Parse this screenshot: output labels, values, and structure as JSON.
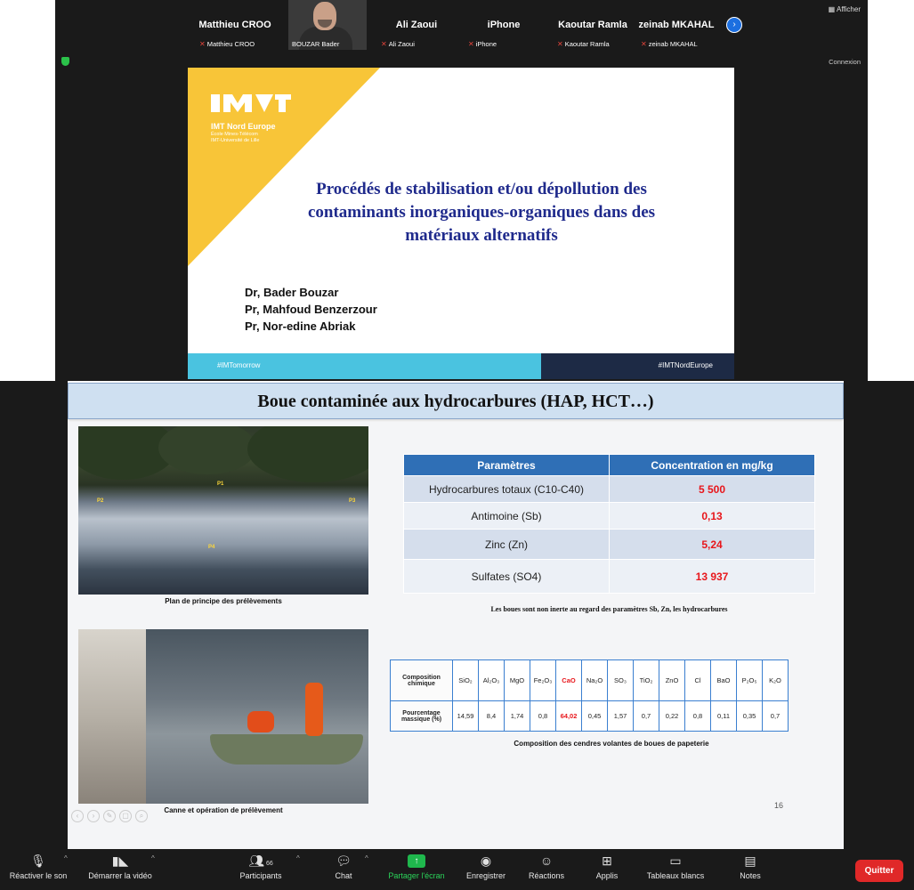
{
  "top_meeting": {
    "participants": [
      {
        "tile_name": "Matthieu CROO",
        "label": "Matthieu CROO",
        "muted": true
      },
      {
        "tile_name": "",
        "label": "BOUZAR Bader",
        "muted": false,
        "video": true
      },
      {
        "tile_name": "Ali Zaoui",
        "label": "Ali Zaoui",
        "muted": true
      },
      {
        "tile_name": "iPhone",
        "label": "iPhone",
        "muted": true
      },
      {
        "tile_name": "Kaoutar Ramla",
        "label": "Kaoutar Ramla",
        "muted": true
      },
      {
        "tile_name": "zeinab MKAHAL",
        "label": "zeinab MKAHAL",
        "muted": true
      }
    ],
    "view_label": "Afficher",
    "connexion_label": "Connexion"
  },
  "slide1": {
    "org_name": "IMT Nord Europe",
    "org_sub1": "École Mines-Télécom",
    "org_sub2": "IMT-Université de Lille",
    "title": "Procédés de stabilisation et/ou dépollution des contaminants inorganiques-organiques dans des matériaux alternatifs",
    "authors": [
      "Dr, Bader Bouzar",
      "Pr, Mahfoud Benzerzour",
      "Pr, Nor-edine Abriak"
    ],
    "footer_left": "#IMTomorrow",
    "footer_right": "#IMTNordEurope",
    "colors": {
      "yellow": "#f8c538",
      "title": "#1f2a8c",
      "footer_left": "#4ac3e0",
      "footer_right": "#1d2a45"
    }
  },
  "slide2": {
    "title": "Boue contaminée aux hydrocarbures (HAP, HCT…)",
    "photo1_points": [
      "P1",
      "P2",
      "P3",
      "P4"
    ],
    "photo1_caption": "Plan de principe des prélèvements",
    "photo2_caption": "Canne et opération de prélèvement",
    "params_table": {
      "headers": [
        "Paramètres",
        "Concentration en mg/kg"
      ],
      "rows": [
        {
          "param": "Hydrocarbures totaux (C10-C40)",
          "value": "5 500"
        },
        {
          "param": "Antimoine (Sb)",
          "value": "0,13"
        },
        {
          "param": "Zinc (Zn)",
          "value": "5,24"
        },
        {
          "param": "Sulfates (SO4)",
          "value": "13 937"
        }
      ]
    },
    "params_note": "Les boues sont non inerte au regard des paramètres Sb, Zn, les hydrocarbures",
    "compo_table": {
      "row1_head": "Composition chimique",
      "row2_head": "Pourcentage massique (%)",
      "columns": [
        "SiO₂",
        "Al₂O₃",
        "MgO",
        "Fe₂O₃",
        "CaO",
        "Na₂O",
        "SO₃",
        "TiO₂",
        "ZnO",
        "Cl",
        "BaO",
        "P₂O₅",
        "K₂O"
      ],
      "values": [
        "14,59",
        "8,4",
        "1,74",
        "0,8",
        "64,02",
        "0,45",
        "1,57",
        "0,7",
        "0,22",
        "0,8",
        "0,11",
        "0,35",
        "0,7"
      ],
      "highlight": "CaO"
    },
    "compo_caption": "Composition des cendres volantes de boues de papeterie",
    "page_number": "16"
  },
  "toolbar": {
    "items": [
      {
        "label": "Réactiver le son",
        "icon": "mic-muted-icon"
      },
      {
        "label": "Démarrer la vidéo",
        "icon": "video-off-icon"
      },
      {
        "label": "Participants",
        "icon": "participants-icon",
        "count": "66"
      },
      {
        "label": "Chat",
        "icon": "chat-icon"
      },
      {
        "label": "Partager l'écran",
        "icon": "share-screen-icon"
      },
      {
        "label": "Enregistrer",
        "icon": "record-icon"
      },
      {
        "label": "Réactions",
        "icon": "reactions-icon"
      },
      {
        "label": "Applis",
        "icon": "apps-icon"
      },
      {
        "label": "Tableaux blancs",
        "icon": "whiteboard-icon"
      },
      {
        "label": "Notes",
        "icon": "notes-icon"
      }
    ],
    "quit_label": "Quitter",
    "colors": {
      "share": "#2bd45a",
      "quit": "#e02828"
    }
  }
}
